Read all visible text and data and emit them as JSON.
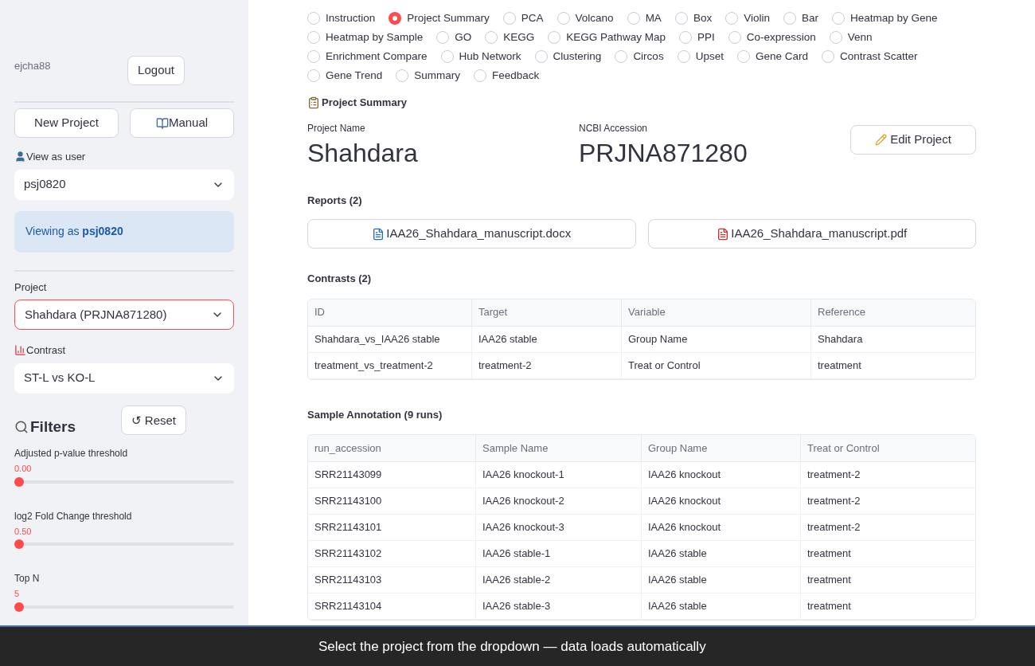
{
  "sidebar": {
    "username": "ejcha88",
    "logout": "Logout",
    "new_project": "New Project",
    "manual": "Manual",
    "view_as": {
      "label": "View as user",
      "value": "psj0820"
    },
    "viewing_notice": "Viewing as **psj0820**",
    "project": {
      "label": "Project",
      "value": "Shahdara (PRJNA871280)"
    },
    "contrast": {
      "label": "Contrast",
      "value": "ST-L vs KO-L"
    },
    "filters_title": "Filters",
    "reset": "↺ Reset",
    "sliders": [
      {
        "label": "Adjusted p-value threshold",
        "reading": "0.00",
        "level": 0
      },
      {
        "label": "log2 Fold Change threshold",
        "reading": "0.50",
        "level": 0
      },
      {
        "label": "Top N",
        "reading": "5",
        "level": 0
      }
    ]
  },
  "nav": [
    {
      "label": "Instruction",
      "selected": false
    },
    {
      "label": "Project Summary",
      "selected": true
    },
    {
      "label": "PCA",
      "selected": false
    },
    {
      "label": "Volcano",
      "selected": false
    },
    {
      "label": "MA",
      "selected": false
    },
    {
      "label": "Box",
      "selected": false
    },
    {
      "label": "Violin",
      "selected": false
    },
    {
      "label": "Bar",
      "selected": false
    },
    {
      "label": "Heatmap by Gene",
      "selected": false
    },
    {
      "label": "Heatmap by Sample",
      "selected": false
    },
    {
      "label": "GO",
      "selected": false
    },
    {
      "label": "KEGG",
      "selected": false
    },
    {
      "label": "KEGG Pathway Map",
      "selected": false
    },
    {
      "label": "PPI",
      "selected": false
    },
    {
      "label": "Co-expression",
      "selected": false
    },
    {
      "label": "Venn",
      "selected": false
    },
    {
      "label": "Enrichment Compare",
      "selected": false
    },
    {
      "label": "Hub Network",
      "selected": false
    },
    {
      "label": "Clustering",
      "selected": false
    },
    {
      "label": "Circos",
      "selected": false
    },
    {
      "label": "Upset",
      "selected": false
    },
    {
      "label": "Gene Card",
      "selected": false
    },
    {
      "label": "Contrast Scatter",
      "selected": false
    },
    {
      "label": "Gene Trend",
      "selected": false
    },
    {
      "label": "Summary",
      "selected": false
    },
    {
      "label": "Feedback",
      "selected": false
    }
  ],
  "summary": {
    "title": "Project Summary",
    "name_label": "Project Name",
    "name": "Shahdara",
    "accession_label": "NCBI Accession",
    "accession": "PRJNA871280",
    "edit": "Edit Project",
    "reports_title": "Reports (2)",
    "reports": [
      {
        "name": "IAA26_Shahdara_manuscript.docx",
        "kind": "docx"
      },
      {
        "name": "IAA26_Shahdara_manuscript.pdf",
        "kind": "pdf"
      }
    ],
    "contrasts_title": "Contrasts (2)",
    "contrasts": {
      "columns": [
        "ID",
        "Target",
        "Variable",
        "Reference"
      ],
      "rows": [
        [
          "Shahdara_vs_IAA26 stable",
          "IAA26 stable",
          "Group Name",
          "Shahdara"
        ],
        [
          "treatment_vs_treatment-2",
          "treatment-2",
          "Treat or Control",
          "treatment"
        ]
      ]
    },
    "samples_title": "Sample Annotation (9 runs)",
    "samples": {
      "columns": [
        "run_accession",
        "Sample Name",
        "Group Name",
        "Treat or Control"
      ],
      "rows": [
        [
          "SRR21143099",
          "IAA26 knockout-1",
          "IAA26 knockout",
          "treatment-2"
        ],
        [
          "SRR21143100",
          "IAA26 knockout-2",
          "IAA26 knockout",
          "treatment-2"
        ],
        [
          "SRR21143101",
          "IAA26 knockout-3",
          "IAA26 knockout",
          "treatment-2"
        ],
        [
          "SRR21143102",
          "IAA26 stable-1",
          "IAA26 stable",
          "treatment"
        ],
        [
          "SRR21143103",
          "IAA26 stable-2",
          "IAA26 stable",
          "treatment"
        ],
        [
          "SRR21143104",
          "IAA26 stable-3",
          "IAA26 stable",
          "treatment"
        ]
      ]
    }
  },
  "caption": "Select the project from the dropdown — data loads automatically"
}
